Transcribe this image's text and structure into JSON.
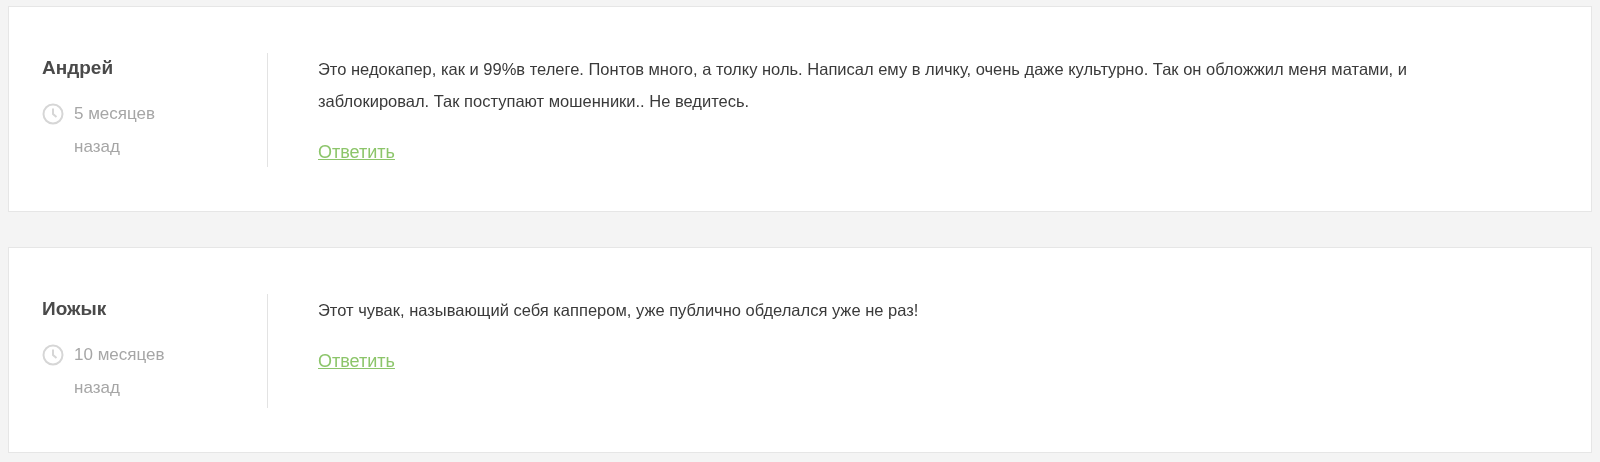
{
  "comments": [
    {
      "author": "Андрей",
      "time": "5 месяцев назад",
      "text": "Это недокапер, как и 99%в телеге. Понтов много, а толку ноль. Написал ему в личку, очень даже культурно. Так он обложжил меня матами, и заблокировал. Так поступают мошенники.. Не ведитесь.",
      "reply": "Ответить"
    },
    {
      "author": "Иожык",
      "time": "10 месяцев назад",
      "text": "Этот чувак, называющий себя каппером, уже публично обделался уже не раз!",
      "reply": "Ответить"
    }
  ]
}
